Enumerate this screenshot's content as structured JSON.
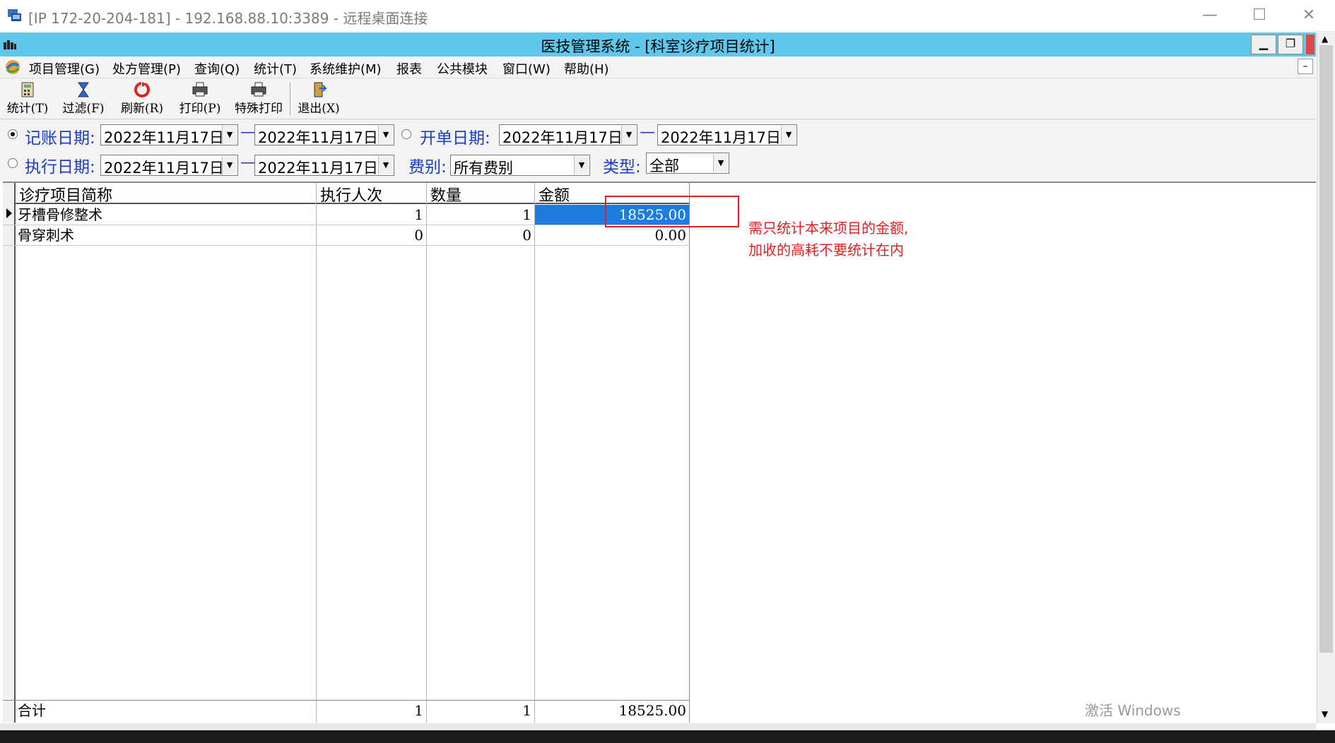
{
  "rdp_window": {
    "title": "[IP 172-20-204-181] - 192.168.88.10:3389 - 远程桌面连接",
    "controls": [
      "—",
      "☐",
      "✕"
    ]
  },
  "app": {
    "title": "医技管理系统 - [科室诊疗项目统计]"
  },
  "menu": [
    "项目管理(G)",
    "处方管理(P)",
    "查询(Q)",
    "统计(T)",
    "系统维护(M)",
    "报表",
    "公共模块",
    "窗口(W)",
    "帮助(H)"
  ],
  "toolbar": [
    {
      "label": "统计(T)",
      "icon": "calculator-icon"
    },
    {
      "label": "过滤(F)",
      "icon": "hourglass-icon"
    },
    {
      "label": "刷新(R)",
      "icon": "refresh-icon"
    },
    {
      "label": "打印(P)",
      "icon": "printer-icon"
    },
    {
      "label": "特殊打印",
      "icon": "printer-icon"
    },
    {
      "label": "退出(X)",
      "icon": "exit-door-icon"
    }
  ],
  "filters": {
    "billing_date": {
      "label": "记账日期:",
      "selected": true,
      "from": "2022年11月17日",
      "to": "2022年11月17日"
    },
    "order_date": {
      "label": "开单日期:",
      "selected": false,
      "from": "2022年11月17日",
      "to": "2022年11月17日"
    },
    "exec_date": {
      "label": "执行日期:",
      "selected": false,
      "from": "2022年11月17日",
      "to": "2022年11月17日"
    },
    "fee_type": {
      "label": "费别:",
      "value": "所有费别"
    },
    "category": {
      "label": "类型:",
      "value": "全部"
    },
    "range_sep": "—"
  },
  "grid": {
    "columns": [
      "诊疗项目简称",
      "执行人次",
      "数量",
      "金额"
    ],
    "rows": [
      {
        "name": "牙槽骨修整术",
        "exec_count": "1",
        "quantity": "1",
        "amount": "18525.00",
        "selected": true
      },
      {
        "name": "骨穿刺术",
        "exec_count": "0",
        "quantity": "0",
        "amount": "0.00",
        "selected": false
      }
    ],
    "total": {
      "name": "合计",
      "exec_count": "1",
      "quantity": "1",
      "amount": "18525.00"
    }
  },
  "annotation": {
    "line1": "需只统计本来项目的金额,",
    "line2": "加收的高耗不要统计在内",
    "color": "#e02020"
  },
  "watermark": "激活 Windows",
  "colors": {
    "title_bar": "#5ec8ec",
    "label_blue": "#1c3cc8",
    "selection": "#1e7be0"
  }
}
